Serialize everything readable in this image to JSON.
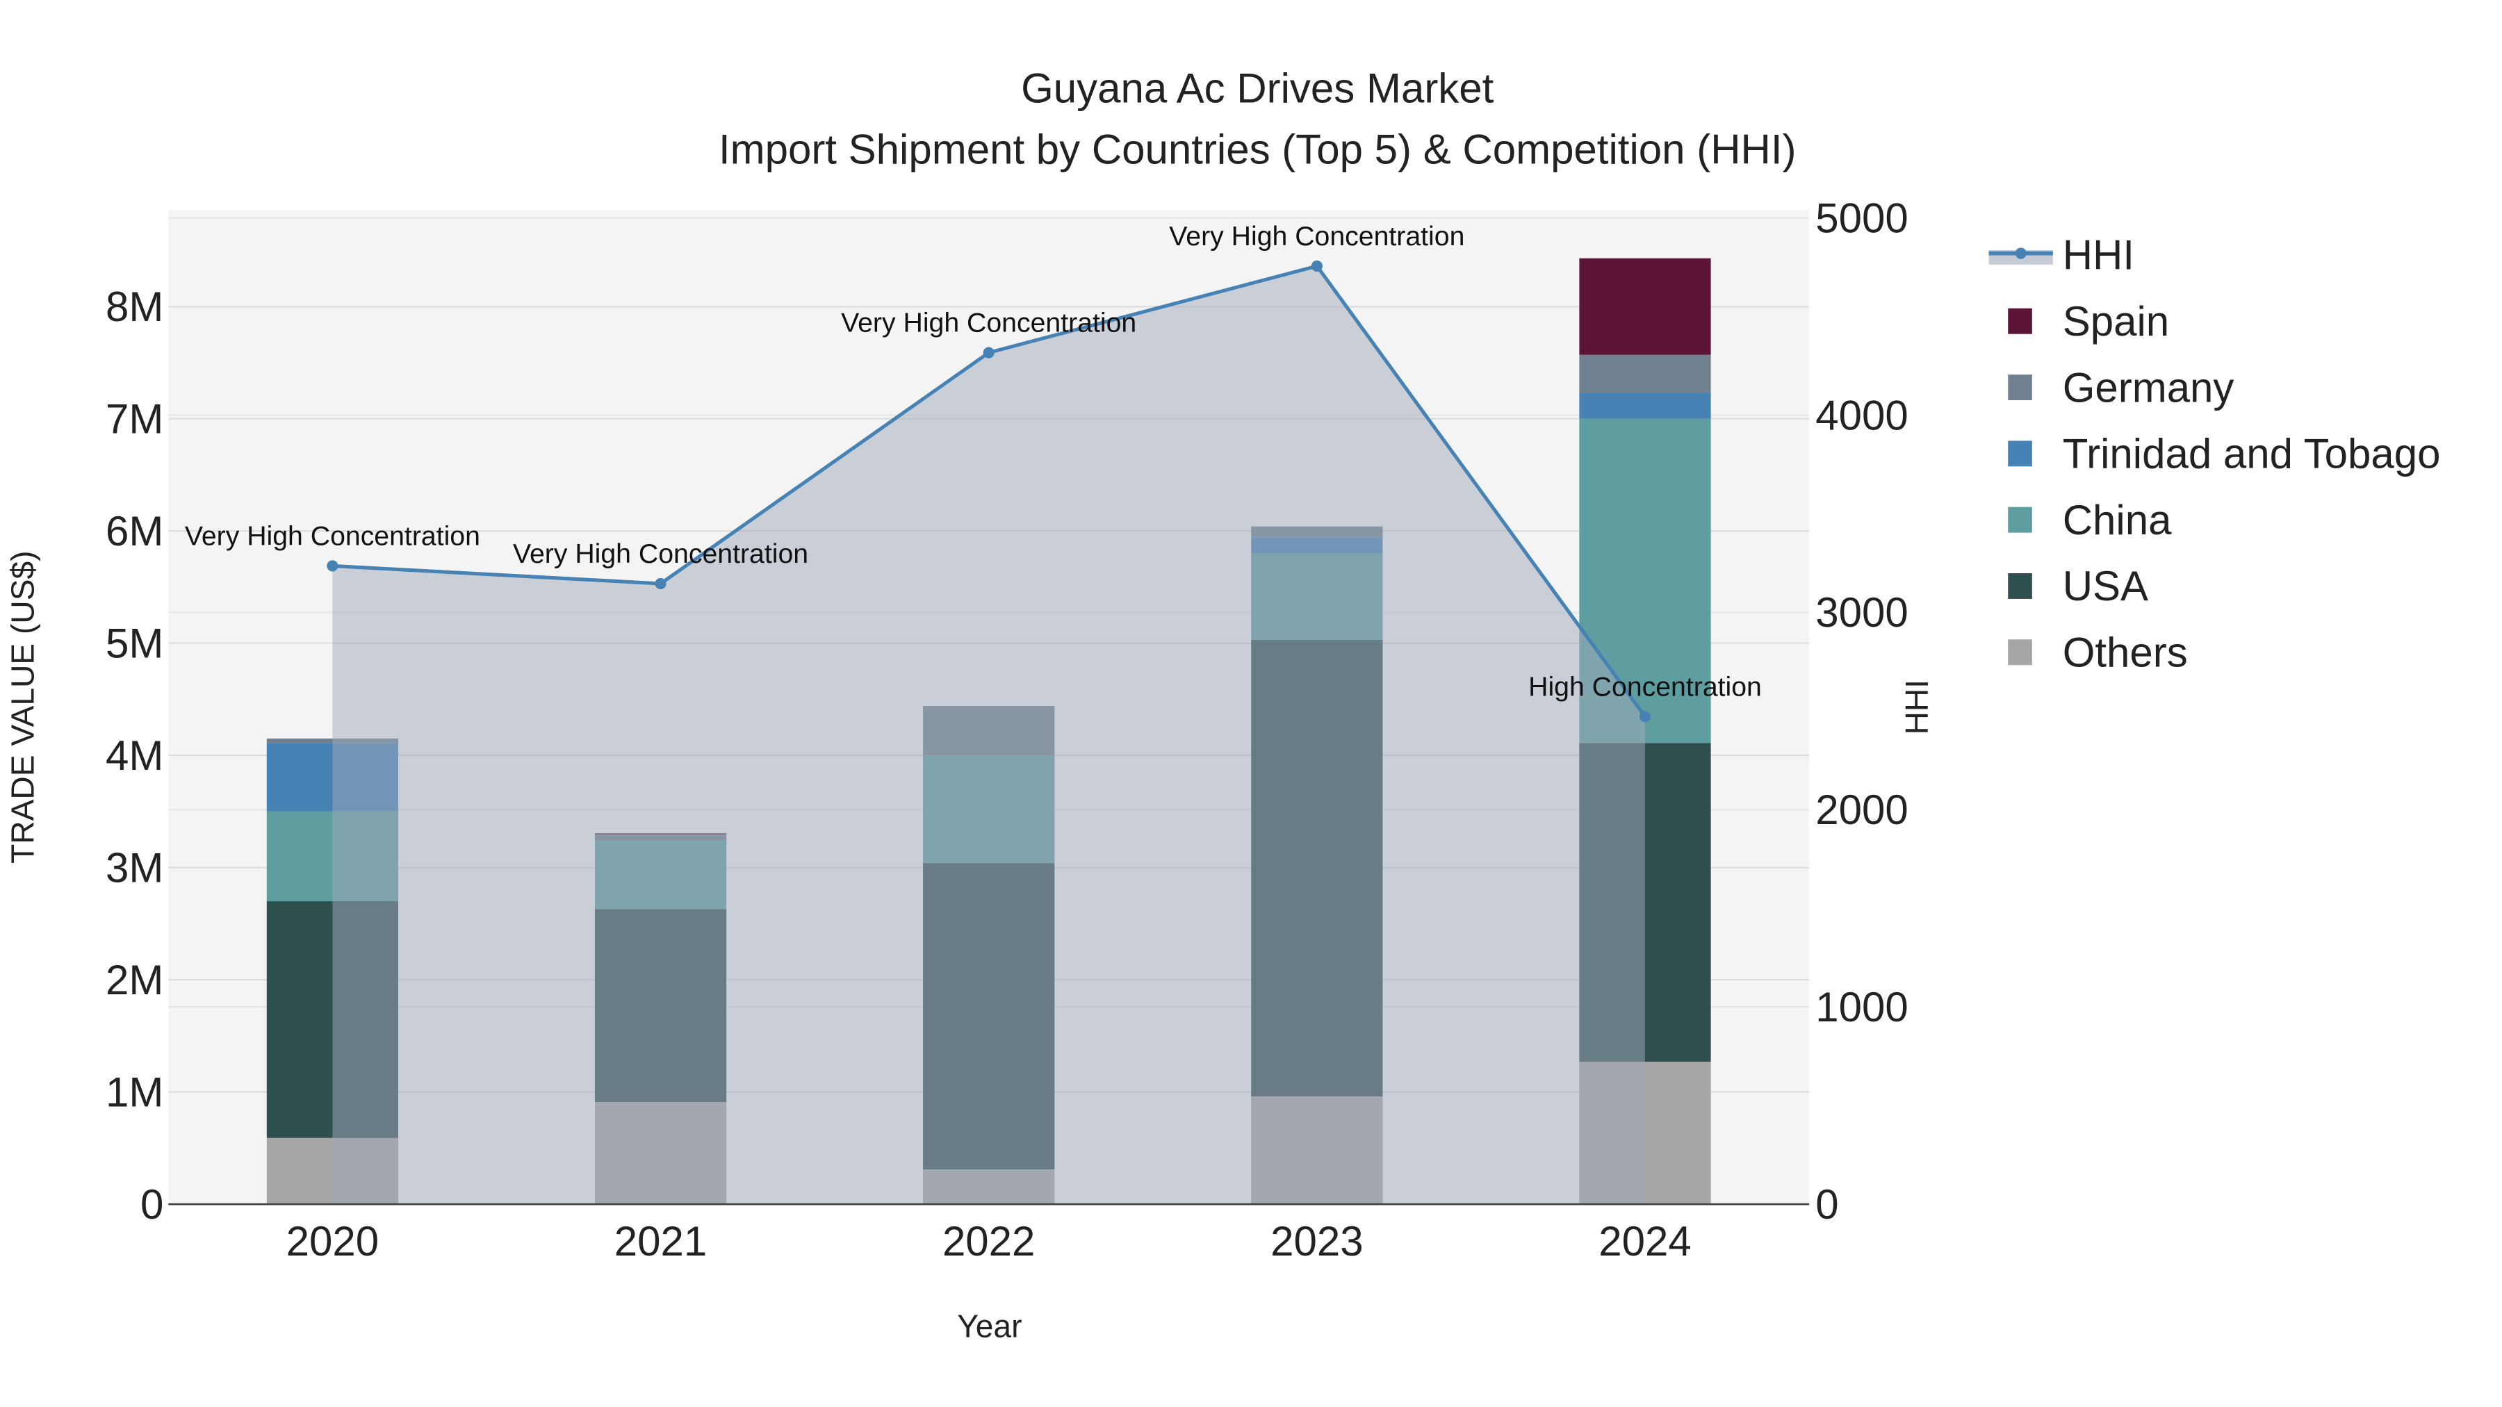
{
  "chart_data": {
    "type": "bar",
    "title": "Guyana Ac Drives Market",
    "subtitle": "Import Shipment by Countries (Top 5) & Competition (HHI)",
    "xlabel": "Year",
    "ylabel": "TRADE VALUE (US$)",
    "y2label": "HHI",
    "categories": [
      "2020",
      "2021",
      "2022",
      "2023",
      "2024"
    ],
    "ylim": [
      0,
      8860000
    ],
    "y2lim": [
      0,
      5040
    ],
    "yticks": [
      {
        "v": 0,
        "l": "0"
      },
      {
        "v": 1000000,
        "l": "1M"
      },
      {
        "v": 2000000,
        "l": "2M"
      },
      {
        "v": 3000000,
        "l": "3M"
      },
      {
        "v": 4000000,
        "l": "4M"
      },
      {
        "v": 5000000,
        "l": "5M"
      },
      {
        "v": 6000000,
        "l": "6M"
      },
      {
        "v": 7000000,
        "l": "7M"
      },
      {
        "v": 8000000,
        "l": "8M"
      }
    ],
    "y2ticks": [
      {
        "v": 0,
        "l": "0"
      },
      {
        "v": 1000,
        "l": "1000"
      },
      {
        "v": 2000,
        "l": "2000"
      },
      {
        "v": 3000,
        "l": "3000"
      },
      {
        "v": 4000,
        "l": "4000"
      },
      {
        "v": 5000,
        "l": "5000"
      }
    ],
    "series": [
      {
        "name": "Others",
        "color": "#a6a6a6",
        "values": [
          590000,
          910000,
          310000,
          960000,
          1270000
        ]
      },
      {
        "name": "USA",
        "color": "#2f4f4f",
        "values": [
          2110000,
          1720000,
          2730000,
          4070000,
          2840000
        ]
      },
      {
        "name": "China",
        "color": "#5f9ea0",
        "values": [
          800000,
          610000,
          960000,
          770000,
          2890000
        ]
      },
      {
        "name": "Trinidad and Tobago",
        "color": "#4682b4",
        "values": [
          610000,
          0,
          0,
          140000,
          230000
        ]
      },
      {
        "name": "Germany",
        "color": "#708090",
        "values": [
          40000,
          60000,
          440000,
          100000,
          340000
        ]
      },
      {
        "name": "Spain",
        "color": "#5c1437",
        "values": [
          0,
          5000,
          0,
          0,
          860000
        ]
      }
    ],
    "hhi": {
      "name": "HHI",
      "color": "#4682b4",
      "values": [
        3236,
        3146,
        4317,
        4756,
        2472
      ],
      "labels": [
        "Very High Concentration",
        "Very High Concentration",
        "Very High Concentration",
        "Very High Concentration",
        "High Concentration"
      ]
    },
    "legend_position": "right",
    "legend": [
      "HHI",
      "Spain",
      "Germany",
      "Trinidad and Tobago",
      "China",
      "USA",
      "Others"
    ]
  }
}
